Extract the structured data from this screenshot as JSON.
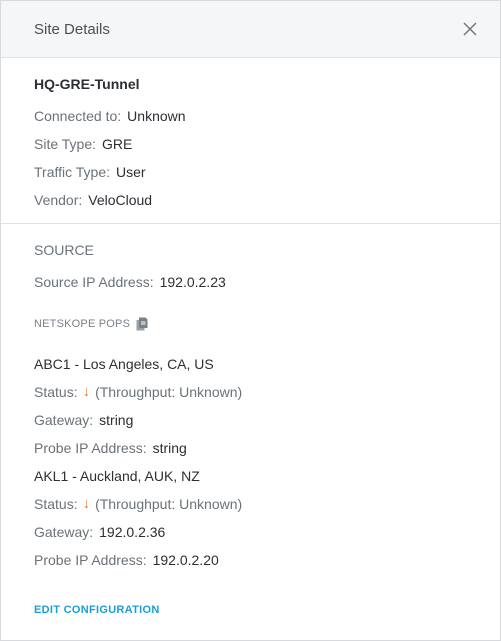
{
  "header": {
    "title": "Site Details"
  },
  "site": {
    "name": "HQ-GRE-Tunnel",
    "connected_to_label": "Connected to:",
    "connected_to": "Unknown",
    "site_type_label": "Site Type:",
    "site_type": "GRE",
    "traffic_type_label": "Traffic Type:",
    "traffic_type": "User",
    "vendor_label": "Vendor:",
    "vendor": "VeloCloud"
  },
  "source": {
    "title": "SOURCE",
    "ip_label": "Source IP Address:",
    "ip": "192.0.2.23"
  },
  "pops": {
    "title": "NETSKOPE POPS",
    "items": [
      {
        "name": "ABC1 - Los Angeles, CA, US",
        "status_label": "Status:",
        "throughput": "(Throughput: Unknown)",
        "gateway_label": "Gateway:",
        "gateway": "string",
        "probe_label": "Probe IP Address:",
        "probe": "string"
      },
      {
        "name": "AKL1 - Auckland, AUK, NZ",
        "status_label": "Status:",
        "throughput": "(Throughput: Unknown)",
        "gateway_label": "Gateway:",
        "gateway": "192.0.2.36",
        "probe_label": "Probe IP Address:",
        "probe": "192.0.2.20"
      }
    ]
  },
  "actions": {
    "edit_label": "EDIT CONFIGURATION"
  },
  "colors": {
    "status_down": "#f07a2b",
    "link": "#1a9fd6"
  },
  "icons": {
    "close": "close-icon",
    "copy": "copy-icon",
    "status": "arrow-down-icon"
  }
}
